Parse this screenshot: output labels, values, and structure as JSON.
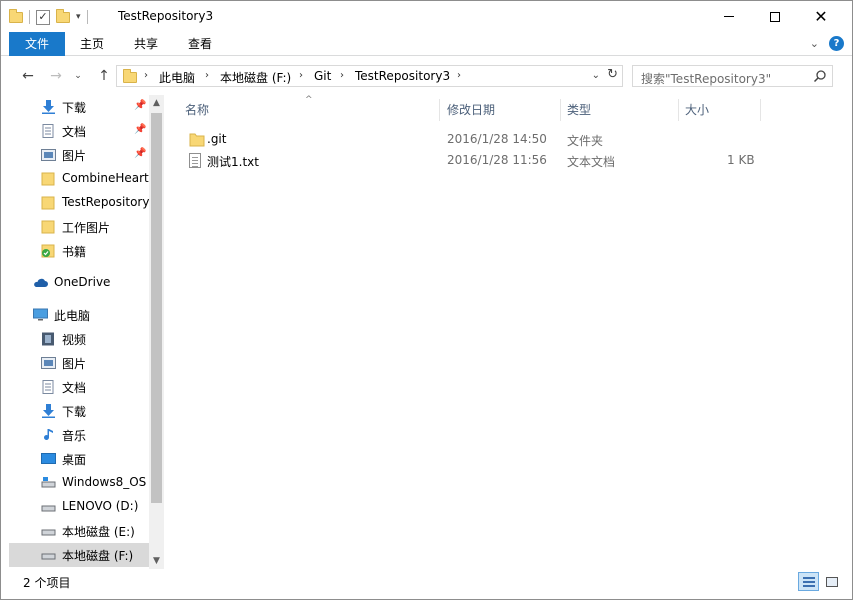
{
  "window": {
    "title": "TestRepository3"
  },
  "ribbon": {
    "tabs": [
      "文件",
      "主页",
      "共享",
      "查看"
    ]
  },
  "address": {
    "crumbs": [
      "此电脑",
      "本地磁盘 (F:)",
      "Git",
      "TestRepository3"
    ]
  },
  "search": {
    "placeholder": "搜索\"TestRepository3\""
  },
  "sidebar": {
    "items": [
      {
        "label": "下载",
        "icon": "download-arrow-icon",
        "pinned": true
      },
      {
        "label": "文档",
        "icon": "document-icon",
        "pinned": true
      },
      {
        "label": "图片",
        "icon": "pictures-icon",
        "pinned": true
      },
      {
        "label": "CombineHeart",
        "icon": "folder-icon"
      },
      {
        "label": "TestRepository",
        "icon": "folder-icon"
      },
      {
        "label": "工作图片",
        "icon": "folder-icon"
      },
      {
        "label": "书籍",
        "icon": "folder-sync-icon"
      },
      {
        "label": "OneDrive",
        "icon": "cloud-icon"
      },
      {
        "label": "此电脑",
        "icon": "computer-icon"
      },
      {
        "label": "视频",
        "icon": "video-icon"
      },
      {
        "label": "图片",
        "icon": "pictures-icon"
      },
      {
        "label": "文档",
        "icon": "document-icon"
      },
      {
        "label": "下载",
        "icon": "download-arrow-icon"
      },
      {
        "label": "音乐",
        "icon": "music-note-icon"
      },
      {
        "label": "桌面",
        "icon": "desktop-icon"
      },
      {
        "label": "Windows8_OS",
        "icon": "drive-icon"
      },
      {
        "label": "LENOVO (D:)",
        "icon": "drive-icon"
      },
      {
        "label": "本地磁盘 (E:)",
        "icon": "drive-icon"
      },
      {
        "label": "本地磁盘 (F:)",
        "icon": "drive-icon",
        "selected": true
      }
    ]
  },
  "columns": {
    "name": "名称",
    "date": "修改日期",
    "type": "类型",
    "size": "大小"
  },
  "files": [
    {
      "name": ".git",
      "date": "2016/1/28 14:50",
      "type": "文件夹",
      "size": "",
      "icon": "folder-icon"
    },
    {
      "name": "测试1.txt",
      "date": "2016/1/28 11:56",
      "type": "文本文档",
      "size": "1 KB",
      "icon": "text-file-icon"
    }
  ],
  "status": {
    "count": "2 个项目"
  },
  "colors": {
    "accent": "#1979ca",
    "selected_bg": "#d9d9d9",
    "header_text": "#4c607a"
  }
}
